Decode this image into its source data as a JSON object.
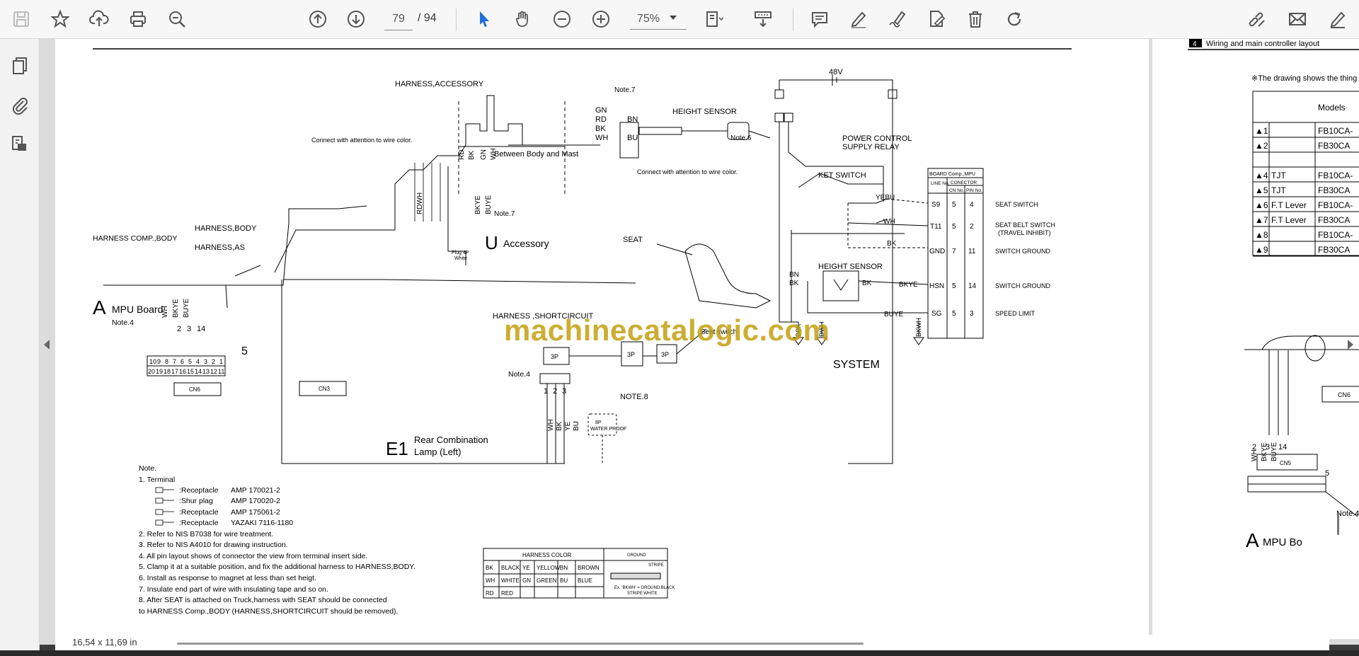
{
  "toolbar": {
    "save_icon": "floppy-disk-icon",
    "bookmark_icon": "star-icon",
    "upload_icon": "cloud-upload-icon",
    "print_icon": "printer-icon",
    "find_icon": "magnifier-icon",
    "page_up_icon": "arrow-up-circle-icon",
    "page_down_icon": "arrow-down-circle-icon",
    "current_page": "79",
    "page_separator": "/",
    "total_pages": "94",
    "select_icon": "cursor-arrow-icon",
    "hand_icon": "hand-pan-icon",
    "zoom_out_icon": "minus-circle-icon",
    "zoom_in_icon": "plus-circle-icon",
    "zoom": "75%"
  },
  "status": {
    "page_size": "16,54 x 11,69 in"
  },
  "watermark": "machinecatalogic.com",
  "drawing": {
    "harness_accessory": "HARNESS,ACCESSORY",
    "note7": "Note.7",
    "height_sensor_top": "HEIGHT SENSOR",
    "note6": "Note.6",
    "gn": "GN",
    "rd": "RD",
    "bk": "BK",
    "wh": "WH",
    "bn": "BN",
    "bu": "BU",
    "connect_attention": "Connect with attention to wire color.",
    "between_body_mast": "Between Body and Mast",
    "harness_comp_body": "HARNESS COMP.,BODY",
    "harness_body": "HARNESS,BODY",
    "harness_as": "HARNESS,AS",
    "u_letter": "U",
    "accessory": "Accessory",
    "plug4p": "Plug 4P",
    "white": "White",
    "a_letter": "A",
    "mpu_board": "MPU Board",
    "note4": "Note.4",
    "pin_2": "2",
    "pin_3": "3",
    "pin_14": "14",
    "pin_5": "5",
    "bkye": "BKYE",
    "buye": "BUYE",
    "rdwh": "RDWH",
    "cn6": "CN6",
    "cn3": "CN3",
    "v48": "48V",
    "power_control": "POWER CONTROL",
    "supply_relay": "SUPPLY RELAY",
    "ket_switch": "KET SWITCH",
    "seat": "SEAT",
    "height_sensor_mid": "HEIGHT SENSOR",
    "harness_shortcircuit": "HARNESS ,SHORTCIRCUIT",
    "seat_switch_lbl": "Seat switch",
    "p3": "3P",
    "note8": "NOTE.8",
    "pins_123": [
      "1",
      "2",
      "3"
    ],
    "yebu": "YEBU",
    "system": "SYSTEM",
    "e1": "E1",
    "rear_combination": "Rear Combination",
    "lamp_left": "Lamp (Left)",
    "water_proof": "WATER PROOF",
    "p8": "8P",
    "board_header": "BOARD Comp.,MPU",
    "line_no": "LINE No.",
    "conector": "CONECTOR",
    "cn_no": "CN No.",
    "pin_no": "PIN No.",
    "board_rows": [
      {
        "line": "S9",
        "cn": "5",
        "pin": "4",
        "label": "SEAT SWITCH",
        "wire": "YEBU"
      },
      {
        "line": "T11",
        "cn": "5",
        "pin": "2",
        "label": "SEAT BELT SWITCH",
        "label2": "(TRAVEL INHIBIT)",
        "wire": "WH"
      },
      {
        "line": "GND",
        "cn": "7",
        "pin": "11",
        "label": "SWITCH GROUND",
        "wire": "BK"
      },
      {
        "line": "HSN",
        "cn": "5",
        "pin": "14",
        "label": "SWITCH GROUND",
        "wire": "BKYE"
      },
      {
        "line": "SG",
        "cn": "5",
        "pin": "3",
        "label": "SPEED LIMIT",
        "wire": "BUYE"
      }
    ],
    "dbk": "DBK",
    "dwh": "DWH",
    "bkwh": "BKWH",
    "ye": "YE",
    "note_title": "Note.",
    "terminal": "1. Terminal",
    "terminals": [
      {
        "type": ":Receptacle",
        "part": "AMP 170021-2"
      },
      {
        "type": ":Shur plag",
        "part": "AMP 170020-2"
      },
      {
        "type": ":Receptacle",
        "part": "AMP 175061-2"
      },
      {
        "type": ":Receptacle",
        "part": "YAZAKI 7116-1180"
      }
    ],
    "notes": [
      "2. Refer to NIS B7038 for wire treatment.",
      "3. Refer to NIS A4010 for drawing instruction.",
      "4. All pin layout shows of connector the view from terminal insert side.",
      "5. Clamp it at a suitable position, and fix the additional harness to HARNESS,BODY.",
      "6. Install as response to magnet at less than set heigt.",
      "7. Insulate end part of wire with insulating tape and so on.",
      "8. After SEAT is attached on Truck,harness with SEAT should be connected",
      "to HARNESS Comp.,BODY (HARNESS,SHORTCIRCUIT should be removed)."
    ],
    "harness_color_title": "HARNESS COLOR",
    "colors": [
      [
        "BK",
        "BLACK",
        "YE",
        "YELLOW",
        "BN",
        "BROWN"
      ],
      [
        "WH",
        "WHITE",
        "GN",
        "GREEN",
        "BU",
        "BLUE"
      ],
      [
        "RD",
        "RED",
        "",
        "",
        "",
        ""
      ]
    ],
    "ground": "GROUND",
    "stripe": "STRIPE",
    "example": "Ex. 'BKWH' = GROUND:BLACK",
    "example2": "STRIPE:WHITE"
  },
  "page2": {
    "section_num": "4",
    "section_title": "Wiring and main controller layout",
    "drawing_note": "※The drawing shows the thing",
    "models_header": "Models",
    "rows": [
      {
        "mark": "▲1",
        "name": "",
        "model": "FB10CA-"
      },
      {
        "mark": "▲2",
        "name": "",
        "model": "FB30CA"
      },
      {
        "mark": "",
        "name": "",
        "model": ""
      },
      {
        "mark": "▲4",
        "name": "TJT",
        "model": "FB10CA-"
      },
      {
        "mark": "▲5",
        "name": "TJT",
        "model": "FB30CA"
      },
      {
        "mark": "▲6",
        "name": "F.T Lever",
        "model": "FB10CA-"
      },
      {
        "mark": "▲7",
        "name": "F.T Lever",
        "model": "FB30CA"
      },
      {
        "mark": "▲8",
        "name": "",
        "model": "FB10CA-"
      },
      {
        "mark": "▲9",
        "name": "",
        "model": "FB30CA"
      }
    ],
    "wh": "WH",
    "bkye": "BKYE",
    "buye": "BUYE",
    "pins": [
      "2",
      "3",
      "14"
    ],
    "cn5": "CN5",
    "cn6": "CN6",
    "five": "5",
    "note4": "Note.4",
    "a_letter": "A",
    "mpu": "MPU Bo"
  }
}
